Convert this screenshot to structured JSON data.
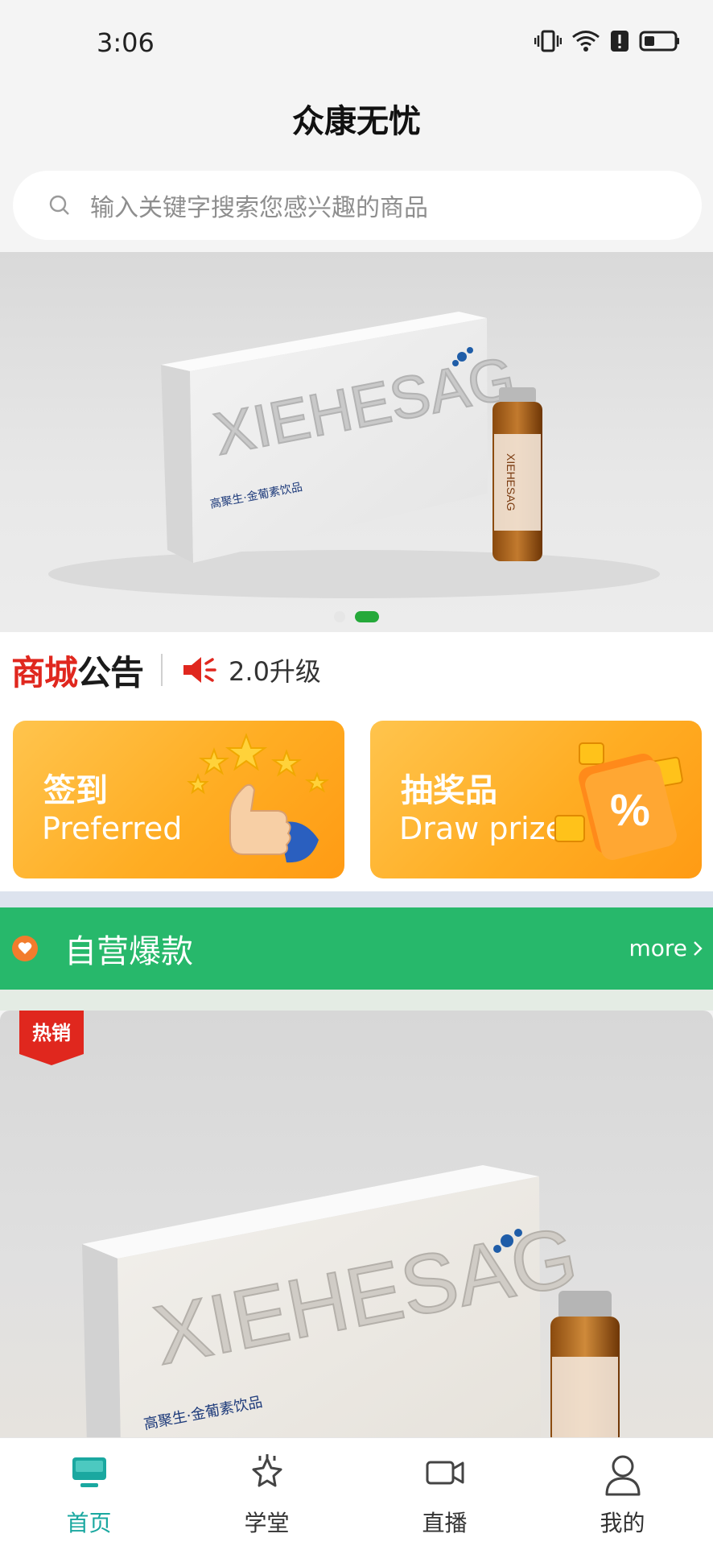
{
  "status": {
    "time": "3:06"
  },
  "header": {
    "title": "众康无忧"
  },
  "search": {
    "placeholder": "输入关键字搜索您感兴趣的商品"
  },
  "banner": {
    "brand": "XIEHESAG",
    "box_caption": "高聚生·金葡素饮品",
    "dots": 2,
    "active_dot": 1
  },
  "notice": {
    "logo_part1": "商城",
    "logo_part2": "公告",
    "text": "2.0升级"
  },
  "promos": [
    {
      "title": "签到",
      "subtitle": "Preferred"
    },
    {
      "title": "抽奖品",
      "subtitle": "Draw prizes"
    }
  ],
  "section": {
    "title": "自营爆款",
    "more": "more"
  },
  "product": {
    "badge": "热销",
    "brand": "XIEHESAG",
    "box_caption": "高聚生·金葡素饮品"
  },
  "tabs": [
    {
      "label": "首页",
      "icon": "monitor-icon",
      "active": true
    },
    {
      "label": "学堂",
      "icon": "star-icon",
      "active": false
    },
    {
      "label": "直播",
      "icon": "video-icon",
      "active": false
    },
    {
      "label": "我的",
      "icon": "user-icon",
      "active": false
    }
  ],
  "colors": {
    "accent": "#27b86b",
    "tab_active": "#1aa8a0",
    "notice_red": "#e0271e",
    "promo_orange": "#ffad23"
  }
}
